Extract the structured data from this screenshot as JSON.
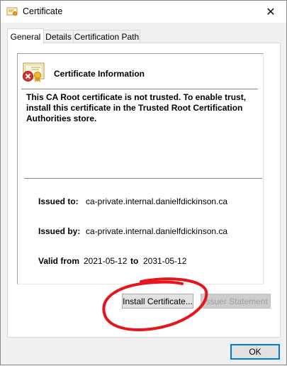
{
  "window": {
    "title": "Certificate",
    "close_glyph": "✕"
  },
  "tabs": [
    {
      "label": "General",
      "active": true
    },
    {
      "label": "Details",
      "active": false
    },
    {
      "label": "Certification Path",
      "active": false
    }
  ],
  "info": {
    "heading": "Certificate Information",
    "warning": "This CA Root certificate is not trusted. To enable trust, install this certificate in the Trusted Root Certification Authorities store."
  },
  "fields": {
    "issued_to_label": "Issued to:",
    "issued_to_value": "ca-private.internal.danielfdickinson.ca",
    "issued_by_label": "Issued by:",
    "issued_by_value": "ca-private.internal.danielfdickinson.ca",
    "valid_from_label": "Valid from",
    "valid_from_value": "2021-05-12",
    "valid_to_label": "to",
    "valid_to_value": "2031-05-12"
  },
  "buttons": {
    "install": "Install Certificate...",
    "issuer_statement": "Issuer Statement",
    "ok": "OK"
  },
  "colors": {
    "annotation_red": "#e8141c",
    "focus_blue": "#0078d7"
  }
}
